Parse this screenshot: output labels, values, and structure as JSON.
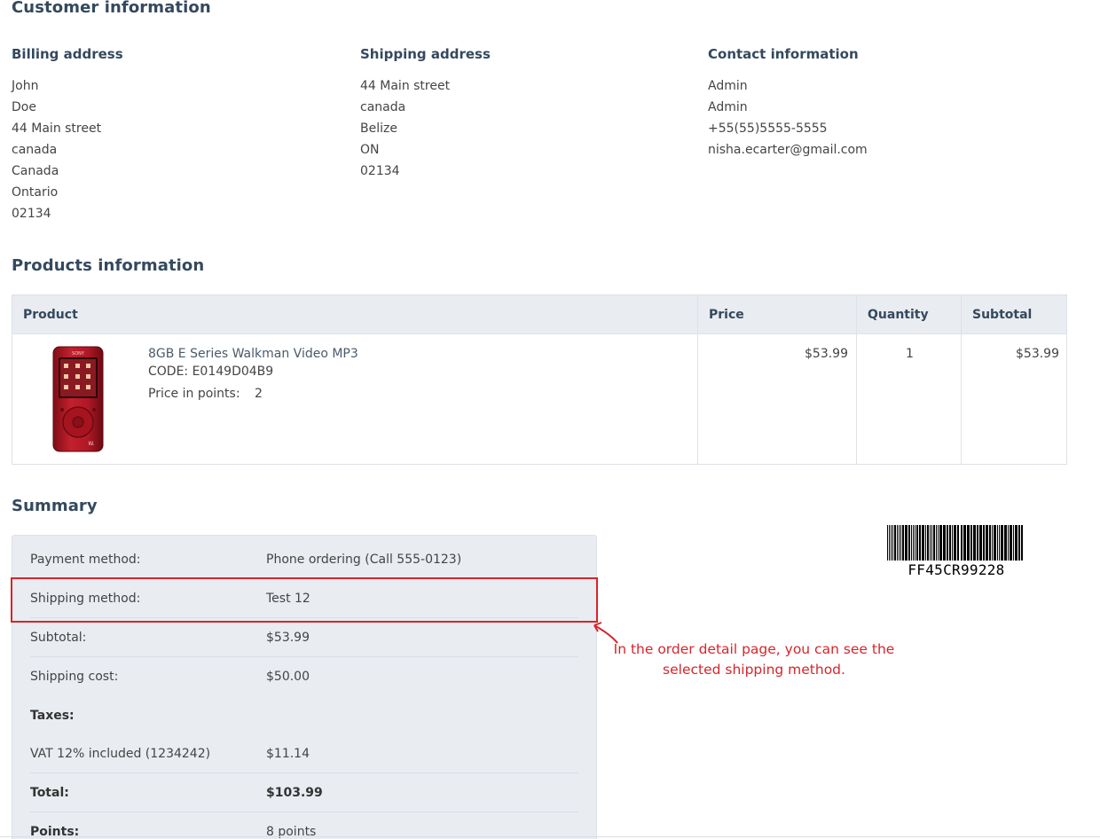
{
  "customer": {
    "title": "Customer information",
    "billing": {
      "heading": "Billing address",
      "lines": [
        "John",
        "Doe",
        "44 Main street",
        "canada",
        "Canada",
        "Ontario",
        "02134"
      ]
    },
    "shipping": {
      "heading": "Shipping address",
      "lines": [
        "44 Main street",
        "canada",
        "Belize",
        "ON",
        "02134"
      ]
    },
    "contact": {
      "heading": "Contact information",
      "lines": [
        "Admin",
        "Admin",
        "+55(55)5555-5555",
        "nisha.ecarter@gmail.com"
      ]
    }
  },
  "products": {
    "title": "Products information",
    "columns": [
      "Product",
      "Price",
      "Quantity",
      "Subtotal"
    ],
    "items": [
      {
        "name": "8GB E Series Walkman Video MP3",
        "code": "CODE: E0149D04B9",
        "points_label": "Price in points:",
        "points_value": "2",
        "price": "$53.99",
        "quantity": "1",
        "subtotal": "$53.99",
        "image_icon": "red-mp3-player-image"
      }
    ]
  },
  "summary": {
    "title": "Summary",
    "rows": [
      {
        "label": "Payment method:",
        "value": "Phone ordering (Call 555-0123)"
      },
      {
        "label": "Shipping method:",
        "value": "Test 12"
      },
      {
        "label": "Subtotal:",
        "value": "$53.99"
      },
      {
        "label": "Shipping cost:",
        "value": "$50.00"
      },
      {
        "label": "Taxes:",
        "value": ""
      },
      {
        "label": "VAT 12% included (1234242)",
        "value": "$11.14"
      },
      {
        "label": "Total:",
        "value": "$103.99"
      },
      {
        "label": "Points:",
        "value": "8 points"
      }
    ]
  },
  "barcode": {
    "text": "FF45CR99228"
  },
  "annotation": {
    "line1": "In the order detail page, you can see the",
    "line2": "selected shipping method.",
    "color": "#d6252b"
  }
}
